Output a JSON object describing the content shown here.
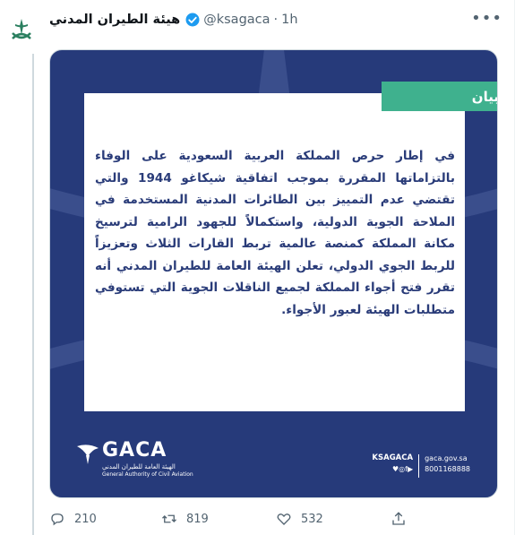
{
  "tweet": {
    "display_name": "هيئة الطيران المدني",
    "handle": "@ksagaca",
    "separator": "·",
    "time": "1h",
    "more": "•••",
    "icons": {
      "avatar": "saudi-emblem-icon",
      "verified": "verified-badge-icon"
    }
  },
  "card": {
    "tag": "بيان",
    "body": "في إطار حرص المملكة العربية السعودية على الوفاء بالتزاماتها المقررة بموجب اتفاقية شيكاغو 1944 والتي تقتضي عدم التمييز بين الطائرات المدنية المستخدمة في الملاحة الجوية الدولية، واستكمالاً للجهود الرامية لترسيخ مكانة المملكة كمنصة عالمية تربط القارات الثلاث وتعزيزاً للربط الجوي الدولي، تعلن الهيئة العامة للطيران المدني أنه تقرر فتح أجواء المملكة لجميع الناقلات الجوية التي تستوفي متطلبات الهيئة لعبور الأجواء.",
    "logo_word": "GACA",
    "logo_ar": "الهيئة العامة للطيران المدني",
    "logo_en": "General Authority of Civil Aviation",
    "contact_handle": "KSAGACA",
    "social_icons": "♥◎f▶",
    "website": "gaca.gov.sa",
    "phone": "8001168888",
    "colors": {
      "background": "#263a7a",
      "tag": "#3fb18e",
      "text": "#2a3c79"
    }
  },
  "actions": {
    "replies": "210",
    "retweets": "819",
    "likes": "532",
    "icons": [
      "reply-icon",
      "retweet-icon",
      "like-icon",
      "share-icon"
    ]
  }
}
